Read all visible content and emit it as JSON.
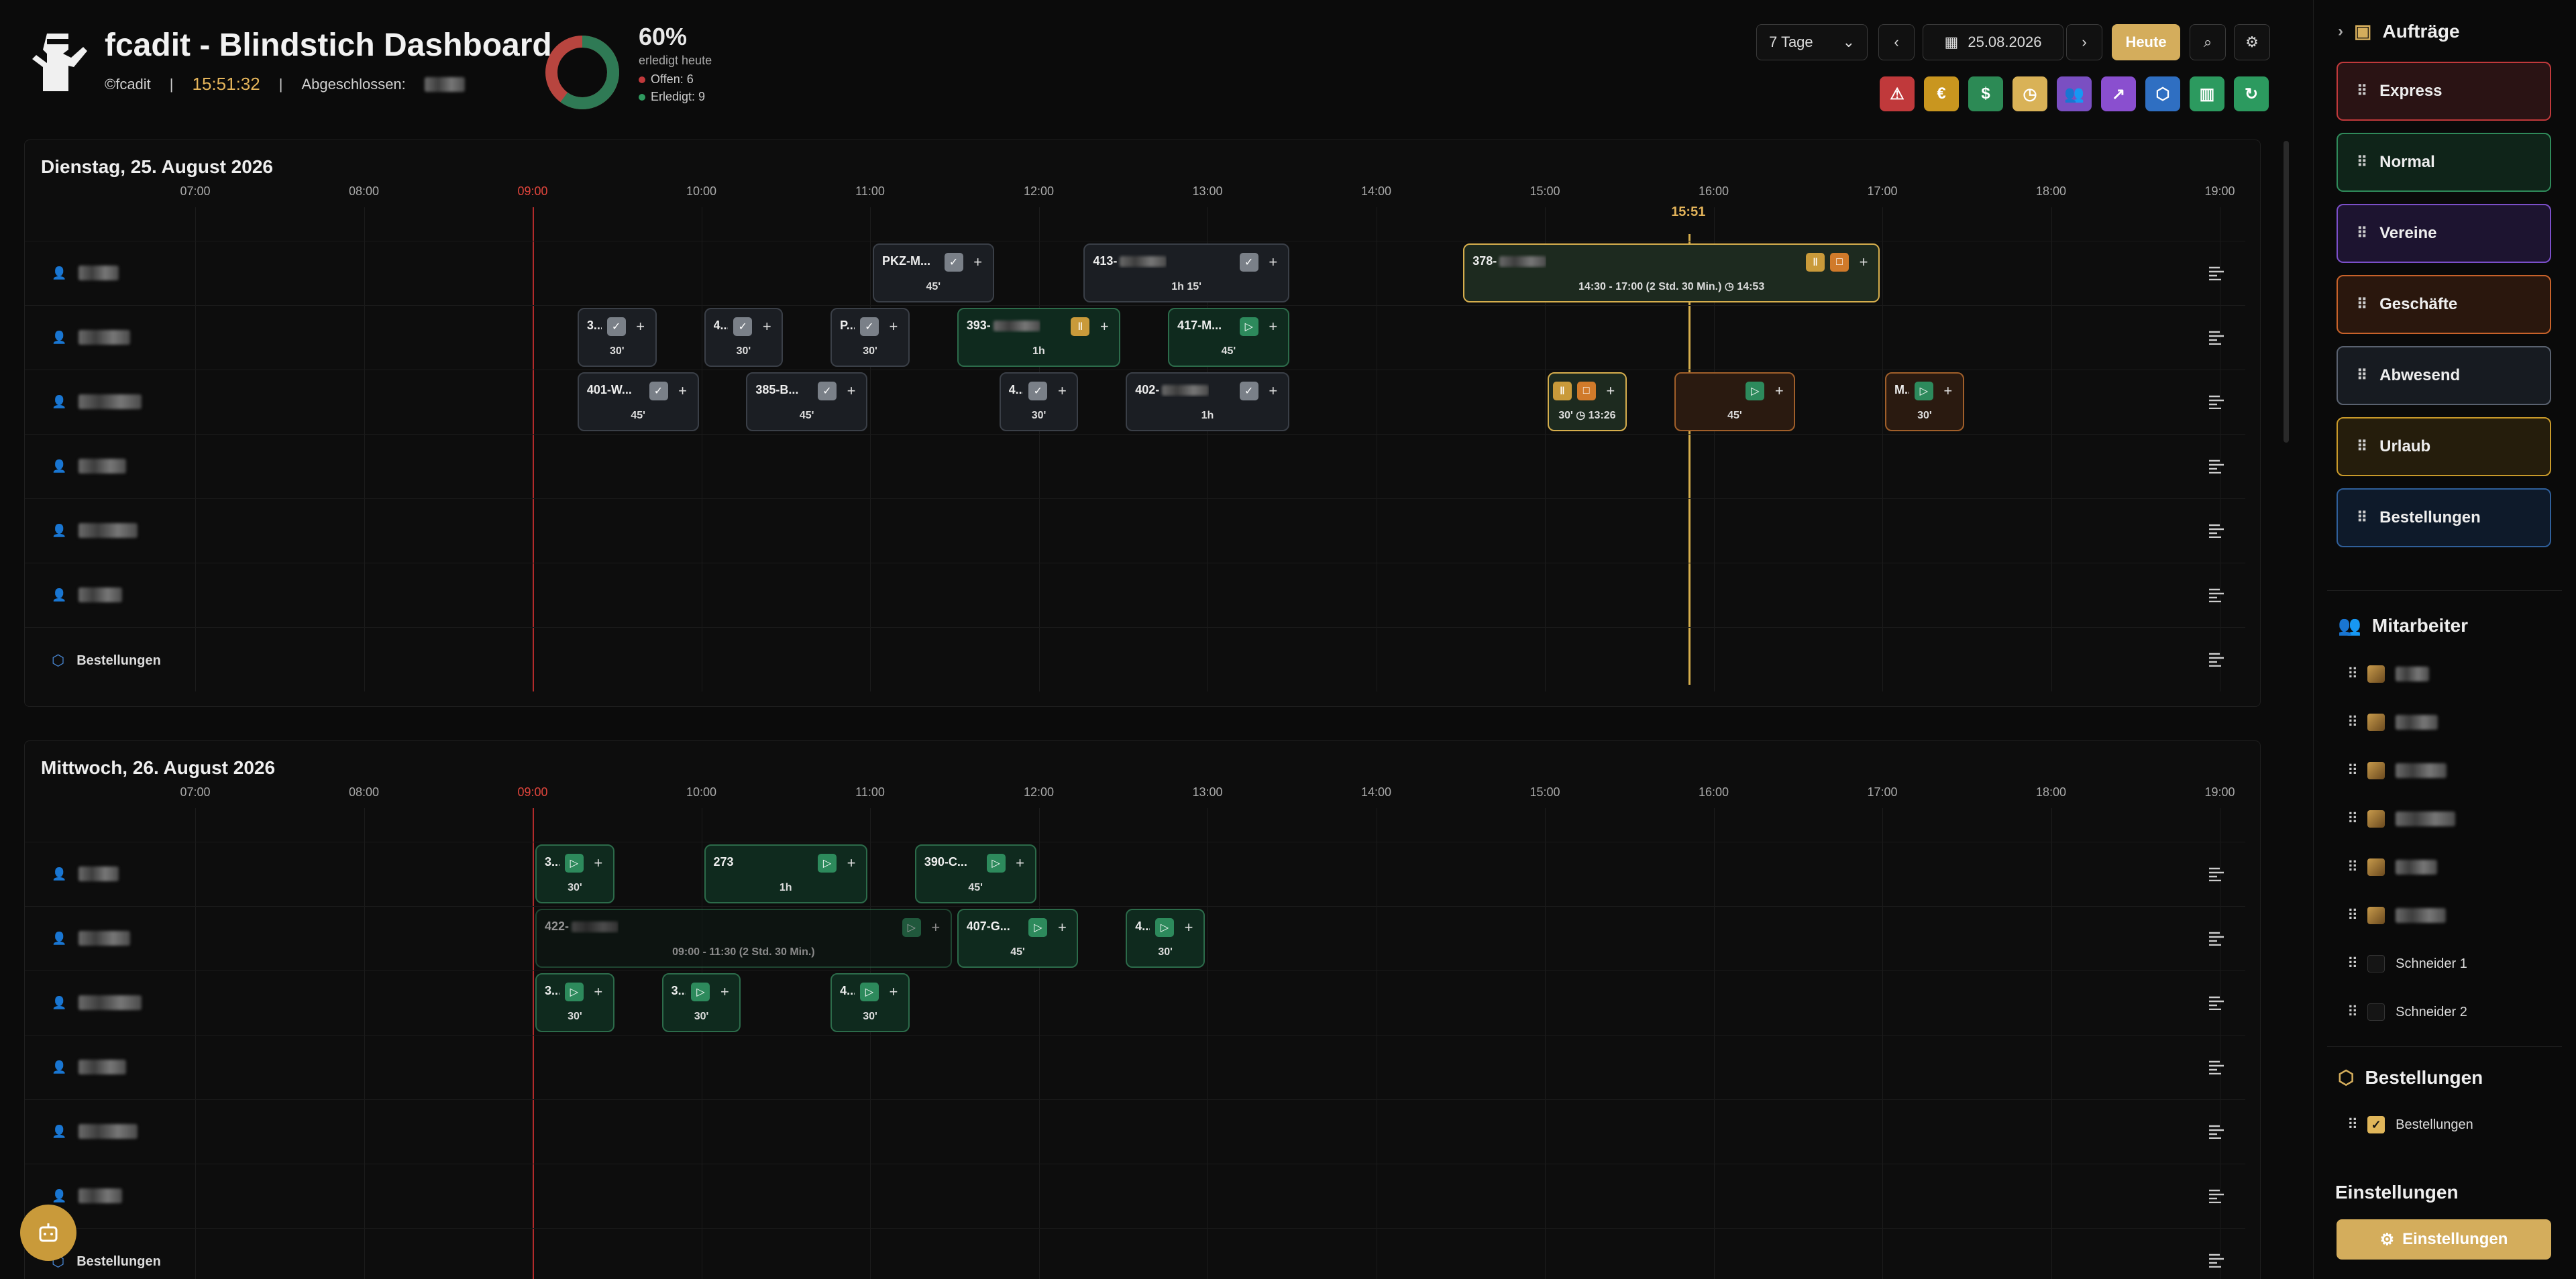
{
  "header": {
    "title": "fcadit - Blindstich Dashboard",
    "copyright": "©fcadit",
    "separator": "|",
    "time": "15:51:32",
    "completed_label": "Abgeschlossen:",
    "percent": "60%",
    "percent_label": "erledigt heute",
    "open_label": "Offen: 6",
    "done_label": "Erledigt: 9",
    "donut": {
      "done": 9,
      "open": 6,
      "done_color": "#2f7a55",
      "open_color": "#b8453f"
    }
  },
  "toolbar": {
    "range": "7 Tage",
    "date": "25.08.2026",
    "today": "Heute",
    "prev": "‹",
    "next": "›",
    "filters": [
      {
        "icon": "alert-icon",
        "glyph": "⚠",
        "color": "#c0393b"
      },
      {
        "icon": "euro-icon",
        "glyph": "€",
        "color": "#c9961f"
      },
      {
        "icon": "dollar-icon",
        "glyph": "$",
        "color": "#2c8a55"
      },
      {
        "icon": "clock-icon",
        "glyph": "◷",
        "color": "#d9b257"
      },
      {
        "icon": "users-icon",
        "glyph": "👥",
        "color": "#7a4fc2"
      },
      {
        "icon": "trend-icon",
        "glyph": "↗",
        "color": "#8a4fcf"
      },
      {
        "icon": "box-icon",
        "glyph": "⬡",
        "color": "#2f6fc2"
      },
      {
        "icon": "chart-icon",
        "glyph": "▥",
        "color": "#2c9a5f"
      },
      {
        "icon": "refresh-icon",
        "glyph": "↻",
        "color": "#2c9a5f"
      }
    ]
  },
  "hours": [
    "07:00",
    "08:00",
    "09:00",
    "10:00",
    "11:00",
    "12:00",
    "13:00",
    "14:00",
    "15:00",
    "16:00",
    "17:00",
    "18:00",
    "19:00"
  ],
  "now_label": "15:51",
  "orders_row_label": "Bestellungen",
  "days": [
    {
      "title": "Dienstag, 25. August 2026",
      "cards": [
        {
          "row": 0,
          "lbl": "PKZ-M...",
          "dur": "45'",
          "style": "grey",
          "icons": [
            "check",
            "plus"
          ]
        },
        {
          "row": 0,
          "lbl": "413-",
          "dur": "1h 15'",
          "style": "grey",
          "icons": [
            "check",
            "plus"
          ]
        },
        {
          "row": 0,
          "lbl": "378-",
          "dur": "14:30 - 17:00 (2 Std. 30 Min.) ◷ 14:53",
          "style": "gold",
          "icons": [
            "pause",
            "stop",
            "plus"
          ]
        },
        {
          "row": 1,
          "lbl": "3...",
          "dur": "30'",
          "style": "grey",
          "icons": [
            "check",
            "plus"
          ]
        },
        {
          "row": 1,
          "lbl": "4...",
          "dur": "30'",
          "style": "grey",
          "icons": [
            "check",
            "plus"
          ]
        },
        {
          "row": 1,
          "lbl": "P...",
          "dur": "30'",
          "style": "grey",
          "icons": [
            "check",
            "plus"
          ]
        },
        {
          "row": 1,
          "lbl": "393-",
          "dur": "1h",
          "style": "green",
          "icons": [
            "pause",
            "plus"
          ]
        },
        {
          "row": 1,
          "lbl": "417-M...",
          "dur": "45'",
          "style": "green",
          "icons": [
            "play",
            "plus"
          ]
        },
        {
          "row": 2,
          "lbl": "401-W...",
          "dur": "45'",
          "style": "grey",
          "icons": [
            "check",
            "plus"
          ]
        },
        {
          "row": 2,
          "lbl": "385-B...",
          "dur": "45'",
          "style": "grey",
          "icons": [
            "check",
            "plus"
          ]
        },
        {
          "row": 2,
          "lbl": "4...",
          "dur": "30'",
          "style": "grey",
          "icons": [
            "check",
            "plus"
          ]
        },
        {
          "row": 2,
          "lbl": "402-",
          "dur": "1h",
          "style": "grey",
          "icons": [
            "check",
            "plus"
          ]
        },
        {
          "row": 2,
          "lbl": "",
          "dur": "30' ◷ 13:26",
          "style": "goldsmall",
          "icons": [
            "pause",
            "stop",
            "plus"
          ]
        },
        {
          "row": 2,
          "lbl": "",
          "dur": "45'",
          "style": "orange",
          "icons": [
            "play",
            "plus"
          ]
        },
        {
          "row": 2,
          "lbl": "M...",
          "dur": "30'",
          "style": "orange",
          "icons": [
            "play",
            "plus"
          ]
        }
      ]
    },
    {
      "title": "Mittwoch, 26. August 2026",
      "cards": [
        {
          "row": 0,
          "lbl": "3...",
          "dur": "30'",
          "style": "green",
          "icons": [
            "play",
            "plus"
          ]
        },
        {
          "row": 0,
          "lbl": "273",
          "dur": "1h",
          "style": "green",
          "icons": [
            "play",
            "plus"
          ]
        },
        {
          "row": 0,
          "lbl": "390-C...",
          "dur": "45'",
          "style": "green",
          "icons": [
            "play",
            "plus"
          ]
        },
        {
          "row": 1,
          "lbl": "422-",
          "dur": "09:00 - 11:30 (2 Std. 30 Min.)",
          "style": "greenfaded",
          "icons": [
            "play",
            "plus"
          ]
        },
        {
          "row": 1,
          "lbl": "407-G...",
          "dur": "45'",
          "style": "green",
          "icons": [
            "play",
            "plus"
          ]
        },
        {
          "row": 1,
          "lbl": "4...",
          "dur": "30'",
          "style": "green",
          "icons": [
            "play",
            "plus"
          ]
        },
        {
          "row": 2,
          "lbl": "3...",
          "dur": "30'",
          "style": "green",
          "icons": [
            "play",
            "plus"
          ]
        },
        {
          "row": 2,
          "lbl": "3...",
          "dur": "30'",
          "style": "green",
          "icons": [
            "play",
            "plus"
          ]
        },
        {
          "row": 2,
          "lbl": "4...",
          "dur": "30'",
          "style": "green",
          "icons": [
            "play",
            "plus"
          ]
        }
      ]
    }
  ],
  "sidebar": {
    "orders_title": "Aufträge",
    "categories": [
      {
        "label": "Express",
        "color": "#c0393b",
        "bg": "#2a1314"
      },
      {
        "label": "Normal",
        "color": "#2f8a5a",
        "bg": "#0f2419"
      },
      {
        "label": "Vereine",
        "color": "#7b4fc9",
        "bg": "#1d1430"
      },
      {
        "label": "Geschäfte",
        "color": "#c8622a",
        "bg": "#2a170d"
      },
      {
        "label": "Abwesend",
        "color": "#5a6270",
        "bg": "#171b21"
      },
      {
        "label": "Urlaub",
        "color": "#c99a2a",
        "bg": "#251d0c"
      },
      {
        "label": "Bestellungen",
        "color": "#2f5f9a",
        "bg": "#0e1a2a"
      }
    ],
    "staff_title": "Mitarbeiter",
    "staff": [
      "",
      "",
      "",
      "",
      "",
      "",
      "Schneider 1",
      "Schneider 2"
    ],
    "orders_section_title": "Bestellungen",
    "orders_check_label": "Bestellungen",
    "settings_title": "Einstellungen",
    "settings_button": "Einstellungen"
  }
}
